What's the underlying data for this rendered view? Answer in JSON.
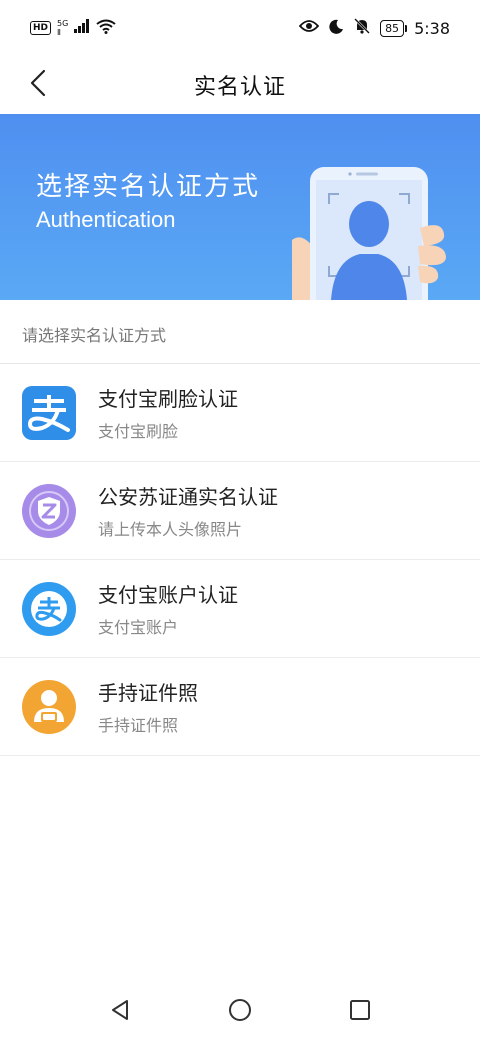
{
  "status_bar": {
    "left_badge": "HD",
    "network_top": "5G",
    "network_bottom": "Ⅱ",
    "battery": "85",
    "time": "5:38",
    "icons": [
      "signal-icon",
      "wifi-icon",
      "eye-icon",
      "moon-icon",
      "bell-off-icon",
      "battery-icon"
    ]
  },
  "header": {
    "title": "实名认证",
    "back_icon": "chevron-left-icon"
  },
  "banner": {
    "title": "选择实名认证方式",
    "subtitle": "Authentication",
    "background_colors": [
      "#4f8ff0",
      "#5aa9f5"
    ]
  },
  "section_hint": "请选择实名认证方式",
  "options": [
    {
      "title": "支付宝刷脸认证",
      "desc": "支付宝刷脸",
      "icon": "alipay-face-icon",
      "color": "#2f8ee8"
    },
    {
      "title": "公安苏证通实名认证",
      "desc": "请上传本人头像照片",
      "icon": "police-shield-icon",
      "color": "#a78be8"
    },
    {
      "title": "支付宝账户认证",
      "desc": "支付宝账户",
      "icon": "alipay-account-icon",
      "color": "#2f9cf0"
    },
    {
      "title": "手持证件照",
      "desc": "手持证件照",
      "icon": "hold-id-icon",
      "color": "#f3a534"
    }
  ],
  "nav_bar": {
    "icons": [
      "back-triangle-icon",
      "home-circle-icon",
      "recent-square-icon"
    ]
  }
}
